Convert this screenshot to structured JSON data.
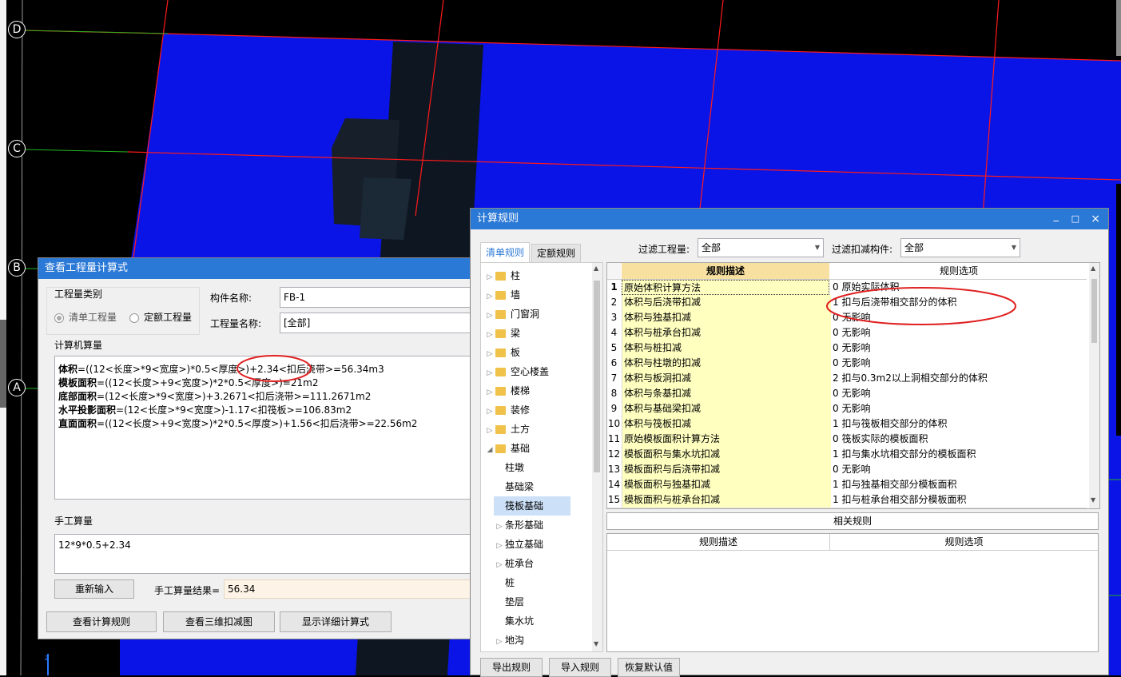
{
  "cad": {
    "axis_labels": [
      "D",
      "C",
      "B",
      "A"
    ]
  },
  "qty_window": {
    "title": "查看工程量计算式",
    "category_group": "工程量类别",
    "radio_qingdan": "清单工程量",
    "radio_dinge": "定额工程量",
    "component_name_label": "构件名称:",
    "component_name_value": "FB-1",
    "qty_name_label": "工程量名称:",
    "qty_name_value": "[全部]",
    "computer_qty_label": "计算机算量",
    "formulas": [
      {
        "name": "体积",
        "expr": "=((12<长度>*9<宽度>)*0.5<厚度>)+2.34<扣后浇带>=56.34m3"
      },
      {
        "name": "模板面积",
        "expr": "=((12<长度>+9<宽度>)*2*0.5<厚度>)=21m2"
      },
      {
        "name": "底部面积",
        "expr": "=(12<长度>*9<宽度>)+3.2671<扣后浇带>=111.2671m2"
      },
      {
        "name": "水平投影面积",
        "expr": "=(12<长度>*9<宽度>)-1.17<扣筏板>=106.83m2"
      },
      {
        "name": "直面面积",
        "expr": "=((12<长度>+9<宽度>)*2*0.5<厚度>)+1.56<扣后浇带>=22.56m2"
      }
    ],
    "manual_qty_label": "手工算量",
    "manual_expr": "12*9*0.5+2.34",
    "reinput_button": "重新输入",
    "manual_result_label": "手工算量结果=",
    "manual_result_value": "56.34",
    "view_rules_button": "查看计算规则",
    "view_3d_button": "查看三维扣减图",
    "show_detail_button": "显示详细计算式"
  },
  "rules_window": {
    "title": "计算规则",
    "win_controls": [
      "_",
      "□",
      "×"
    ],
    "tabs": [
      "清单规则",
      "定额规则"
    ],
    "filter_qty_label": "过滤工程量:",
    "filter_qty_value": "全部",
    "filter_comp_label": "过滤扣减构件:",
    "filter_comp_value": "全部",
    "tree": [
      {
        "label": "柱",
        "type": "folder",
        "expand": "▷"
      },
      {
        "label": "墙",
        "type": "folder",
        "expand": "▷"
      },
      {
        "label": "门窗洞",
        "type": "folder",
        "expand": "▷"
      },
      {
        "label": "梁",
        "type": "folder",
        "expand": "▷"
      },
      {
        "label": "板",
        "type": "folder",
        "expand": "▷"
      },
      {
        "label": "空心楼盖",
        "type": "folder",
        "expand": "▷"
      },
      {
        "label": "楼梯",
        "type": "folder",
        "expand": "▷"
      },
      {
        "label": "装修",
        "type": "folder",
        "expand": "▷"
      },
      {
        "label": "土方",
        "type": "folder",
        "expand": "▷"
      },
      {
        "label": "基础",
        "type": "folder",
        "expand": "◢"
      },
      {
        "label": "柱墩",
        "type": "child",
        "expand": ""
      },
      {
        "label": "基础梁",
        "type": "child",
        "expand": ""
      },
      {
        "label": "筏板基础",
        "type": "child-selected",
        "expand": ""
      },
      {
        "label": "条形基础",
        "type": "child",
        "expand": "▷"
      },
      {
        "label": "独立基础",
        "type": "child",
        "expand": "▷"
      },
      {
        "label": "桩承台",
        "type": "child",
        "expand": "▷"
      },
      {
        "label": "桩",
        "type": "child",
        "expand": ""
      },
      {
        "label": "垫层",
        "type": "child",
        "expand": ""
      },
      {
        "label": "集水坑",
        "type": "child",
        "expand": ""
      },
      {
        "label": "地沟",
        "type": "child",
        "expand": "▷"
      }
    ],
    "table_header_desc": "规则描述",
    "table_header_opt": "规则选项",
    "rows": [
      {
        "n": "1",
        "desc": "原始体积计算方法",
        "opt": "0  原始实际体积"
      },
      {
        "n": "2",
        "desc": "体积与后浇带扣减",
        "opt": "1  扣与后浇带相交部分的体积"
      },
      {
        "n": "3",
        "desc": "体积与独基扣减",
        "opt": "0   无影响"
      },
      {
        "n": "4",
        "desc": "体积与桩承台扣减",
        "opt": "0   无影响"
      },
      {
        "n": "5",
        "desc": "体积与桩扣减",
        "opt": "0   无影响"
      },
      {
        "n": "6",
        "desc": "体积与柱墩的扣减",
        "opt": "0   无影响"
      },
      {
        "n": "7",
        "desc": "体积与板洞扣减",
        "opt": "2  扣与0.3m2以上洞相交部分的体积"
      },
      {
        "n": "8",
        "desc": "体积与条基扣减",
        "opt": "0   无影响"
      },
      {
        "n": "9",
        "desc": "体积与基础梁扣减",
        "opt": "0   无影响"
      },
      {
        "n": "10",
        "desc": "体积与筏板扣减",
        "opt": "1  扣与筏板相交部分的体积"
      },
      {
        "n": "11",
        "desc": "原始模板面积计算方法",
        "opt": "0   筏板实际的模板面积"
      },
      {
        "n": "12",
        "desc": "模板面积与集水坑扣减",
        "opt": "1  扣与集水坑相交部分的模板面积"
      },
      {
        "n": "13",
        "desc": "模板面积与后浇带扣减",
        "opt": "0   无影响"
      },
      {
        "n": "14",
        "desc": "模板面积与独基扣减",
        "opt": "1   扣与独基相交部分模板面积"
      },
      {
        "n": "15",
        "desc": "模板面积与桩承台扣减",
        "opt": "1   扣与桩承台相交部分模板面积"
      }
    ],
    "related_rules_label": "相关规则",
    "related_header_desc": "规则描述",
    "related_header_opt": "规则选项",
    "export_button": "导出规则",
    "import_button": "导入规则",
    "restore_button": "恢复默认值"
  },
  "colors": {
    "slab_blue": "#0a14e6",
    "grid_red": "#ff1a1a",
    "axis_green": "#22b522",
    "titlebar_blue": "#2b79d6",
    "rule_desc_yellow": "#ffffc0",
    "annotation_red": "#e02020"
  }
}
